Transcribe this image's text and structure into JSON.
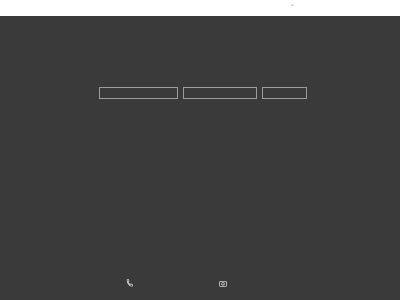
{
  "topbar": {
    "icon": "chevron-down-icon"
  },
  "form": {
    "fields": [
      {
        "value": "",
        "placeholder": ""
      },
      {
        "value": "",
        "placeholder": ""
      },
      {
        "value": "",
        "placeholder": ""
      }
    ]
  },
  "footer": {
    "icons": [
      "phone-icon",
      "camera-icon"
    ]
  },
  "colors": {
    "background": "#3a3a3a",
    "topbar": "#ffffff",
    "field_border": "#9c9c9c"
  }
}
